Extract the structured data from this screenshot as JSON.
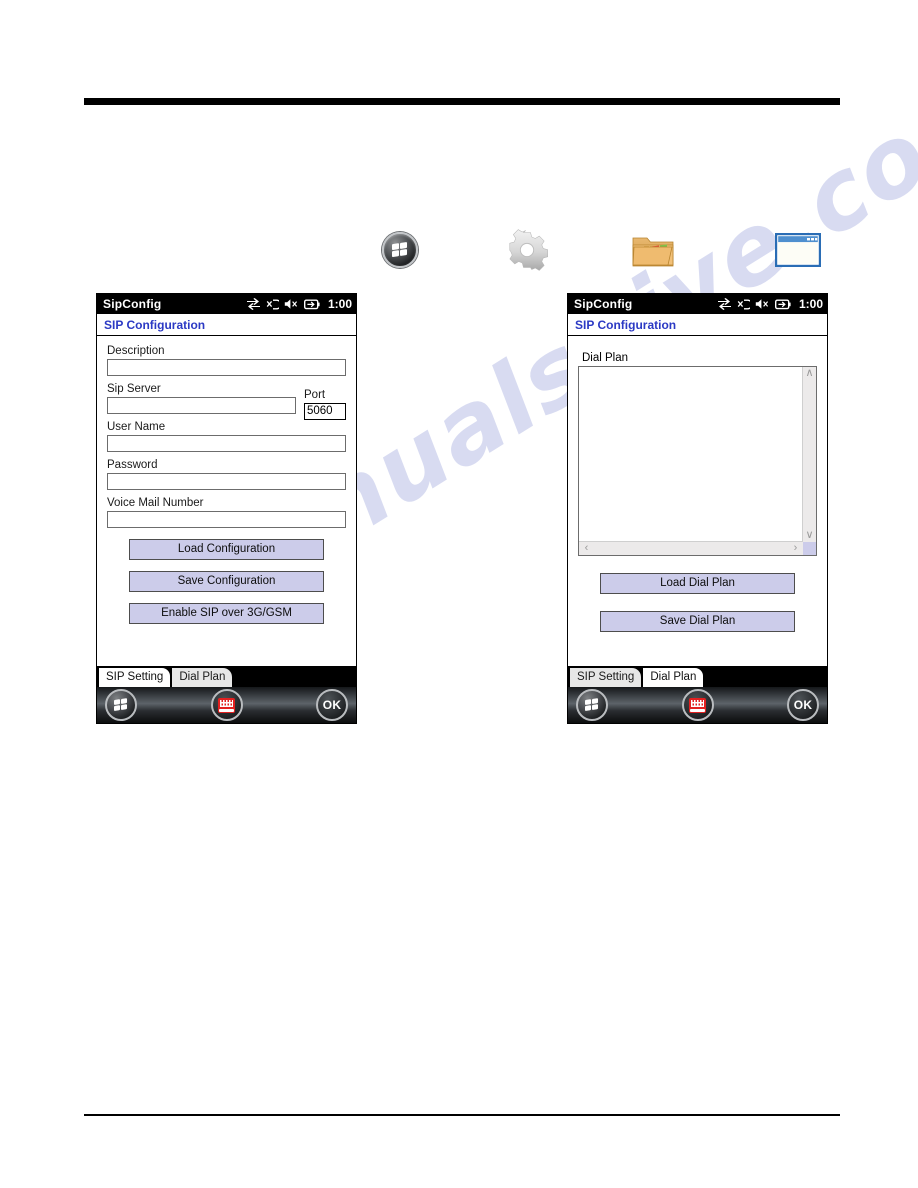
{
  "page": {
    "watermark": "manualshive.com"
  },
  "icon_strip": {
    "icons": [
      {
        "name": "windows-start-orb-icon",
        "label": "Start"
      },
      {
        "name": "settings-gear-icon",
        "label": "Settings"
      },
      {
        "name": "file-explorer-folder-icon",
        "label": "File Explorer"
      },
      {
        "name": "blank-window-icon",
        "label": "Window"
      }
    ]
  },
  "devices": [
    {
      "titlebar": {
        "app_title": "SipConfig",
        "clock": "1:00",
        "status_icons": [
          "network-arrows-icon",
          "signal-antenna-icon",
          "speaker-muted-icon",
          "battery-icon"
        ]
      },
      "header": {
        "title": "SIP Configuration"
      },
      "form": {
        "fields": [
          {
            "label": "Description",
            "value": ""
          },
          {
            "label": "Sip Server",
            "value": ""
          },
          {
            "label": "Port",
            "value": "5060"
          },
          {
            "label": "User Name",
            "value": ""
          },
          {
            "label": "Password",
            "value": ""
          },
          {
            "label": "Voice Mail Number",
            "value": ""
          }
        ],
        "buttons": [
          {
            "label": "Load Configuration"
          },
          {
            "label": "Save Configuration"
          },
          {
            "label": "Enable SIP over 3G/GSM"
          }
        ]
      },
      "tabs": [
        {
          "label": "SIP Setting",
          "active": true
        },
        {
          "label": "Dial Plan",
          "active": false
        }
      ],
      "taskbar": {
        "start_label": "Start",
        "sip_label": "SIP keyboard",
        "ok_label": "OK"
      }
    },
    {
      "titlebar": {
        "app_title": "SipConfig",
        "clock": "1:00",
        "status_icons": [
          "network-arrows-icon",
          "signal-antenna-icon",
          "speaker-muted-icon",
          "battery-icon"
        ]
      },
      "header": {
        "title": "SIP Configuration"
      },
      "dialplan": {
        "label": "Dial Plan",
        "value": "",
        "scroll_up": "∧",
        "scroll_down": "∨",
        "scroll_left": "‹",
        "scroll_right": "›"
      },
      "buttons": [
        {
          "label": "Load Dial Plan"
        },
        {
          "label": "Save Dial Plan"
        }
      ],
      "tabs": [
        {
          "label": "SIP Setting",
          "active": false
        },
        {
          "label": "Dial Plan",
          "active": true
        }
      ],
      "taskbar": {
        "start_label": "Start",
        "sip_label": "SIP keyboard",
        "ok_label": "OK"
      }
    }
  ],
  "colors": {
    "header_blue": "#2b39c4",
    "button_lavender": "#ccccea",
    "watermark": "#b9bfe6"
  }
}
